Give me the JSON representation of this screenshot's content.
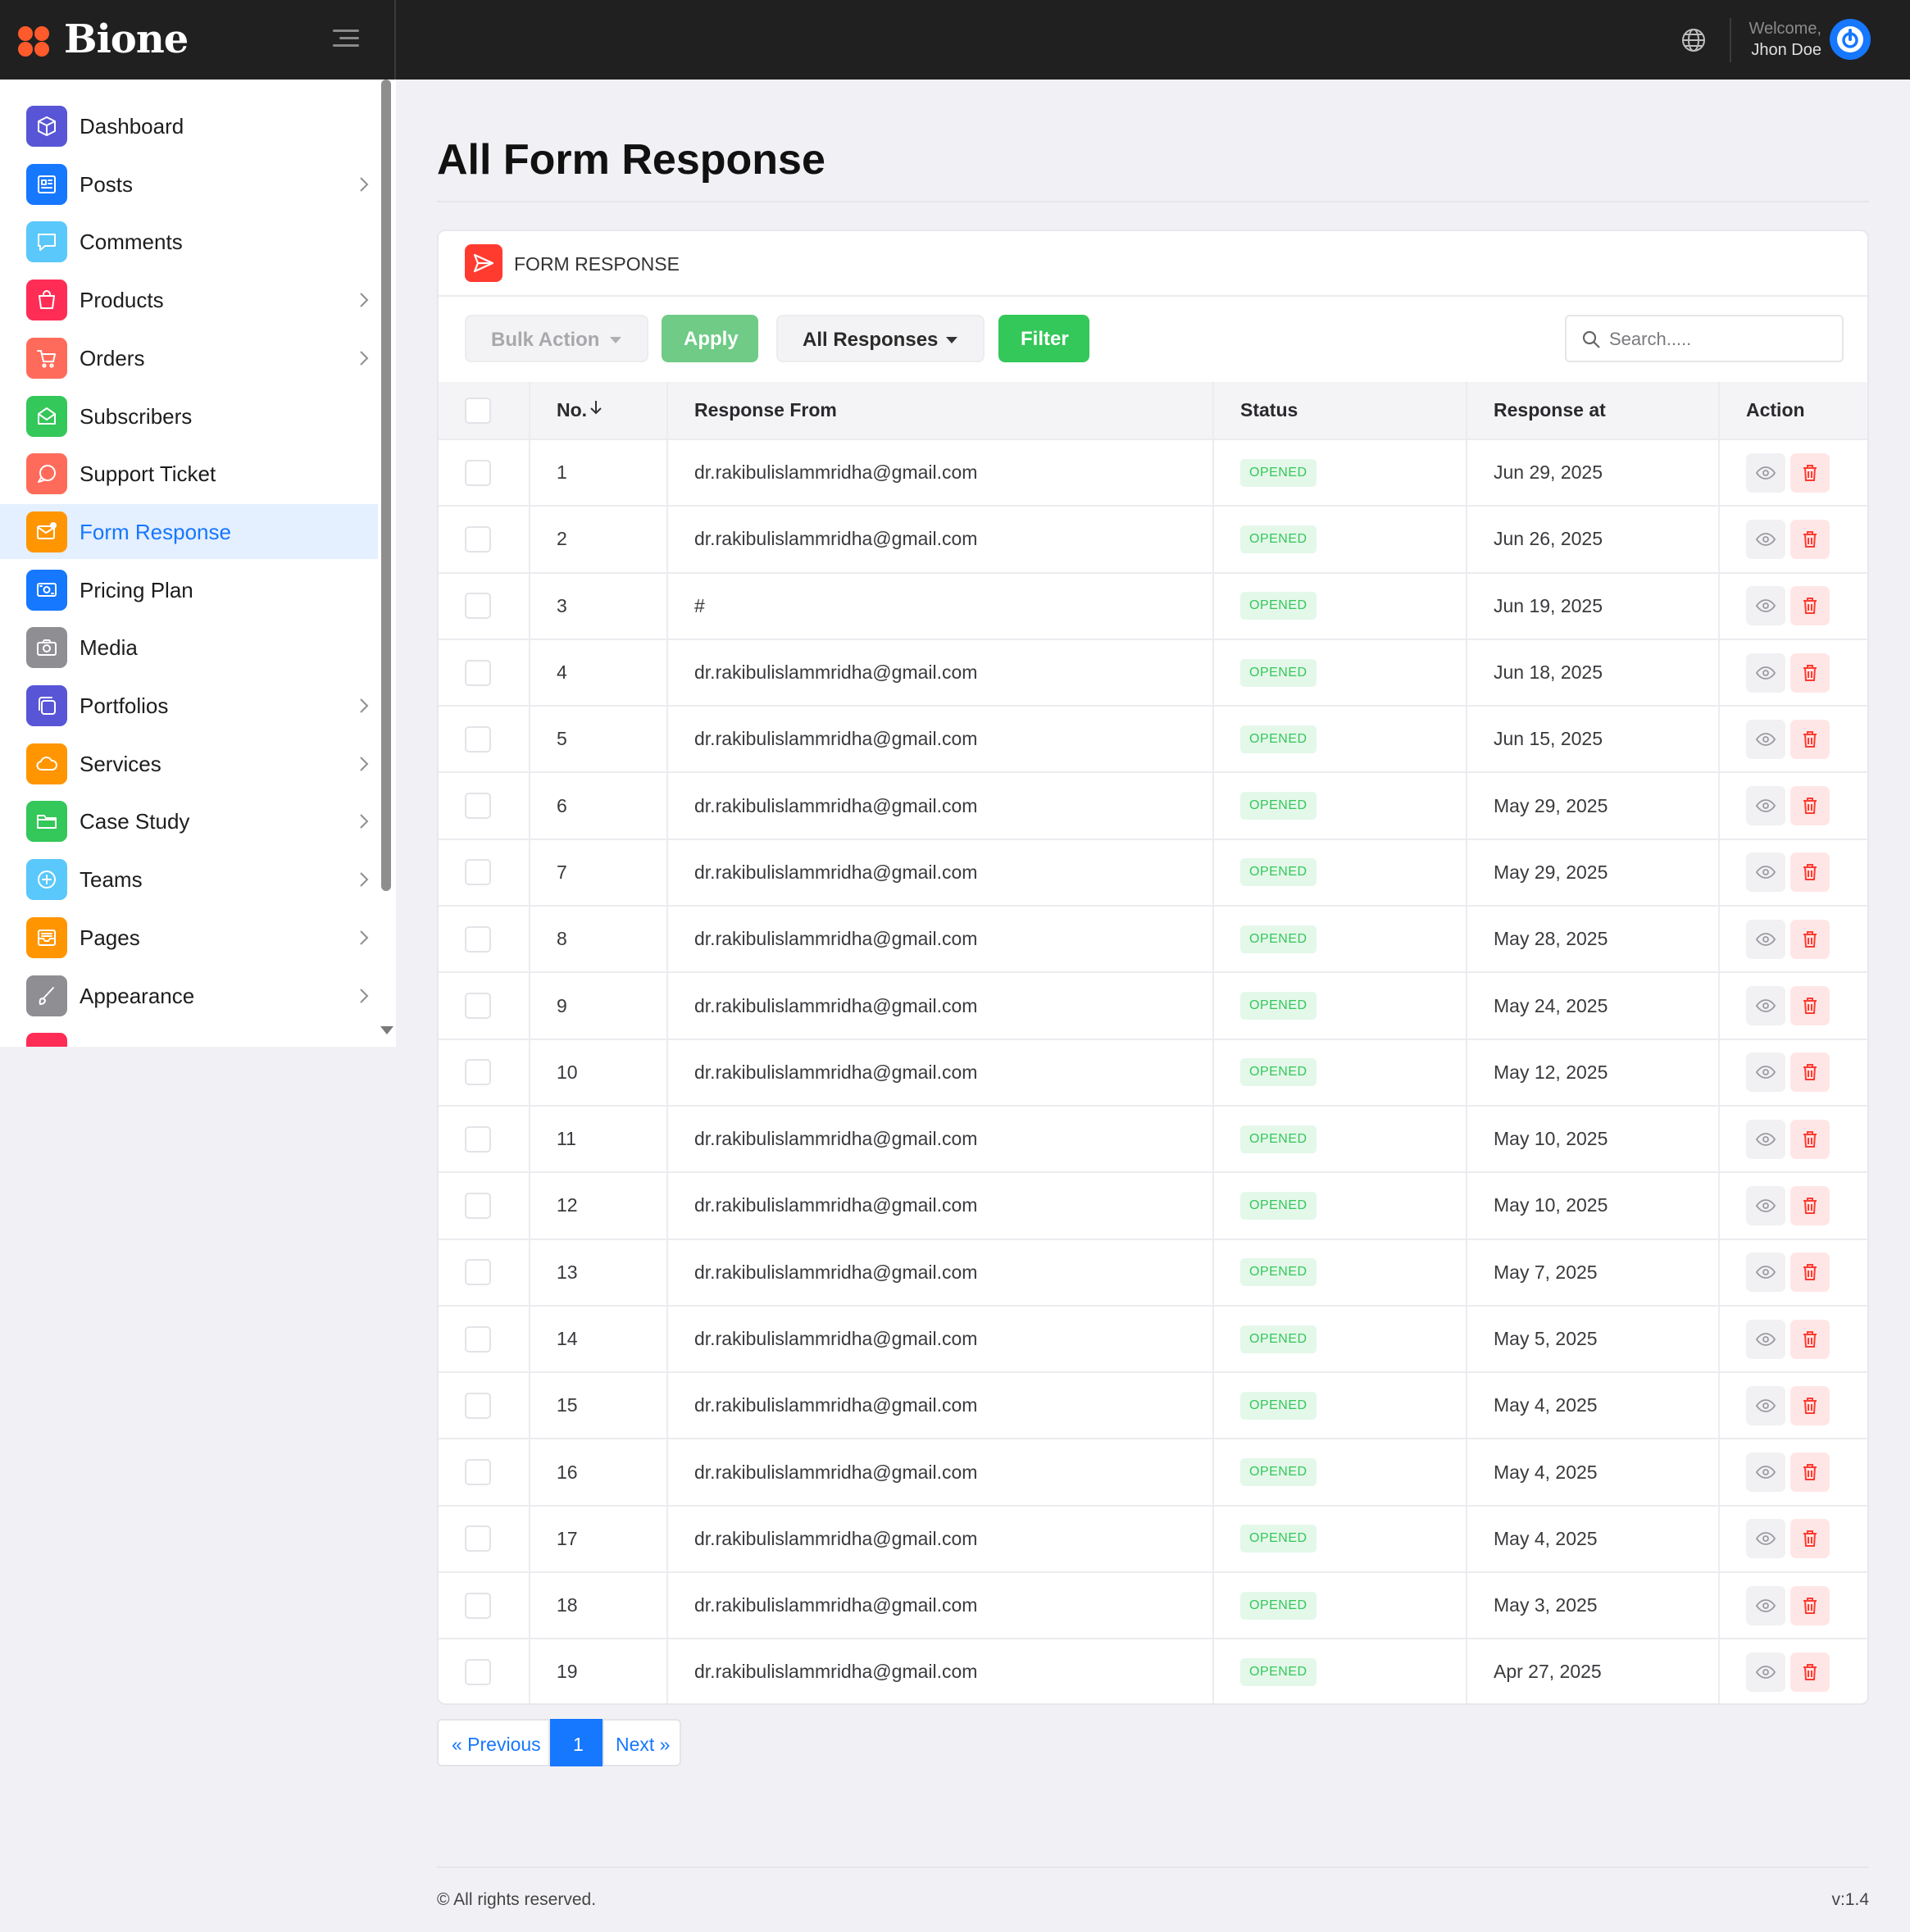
{
  "brand": {
    "name": "Bione"
  },
  "header": {
    "welcome": "Welcome,",
    "user": "Jhon Doe"
  },
  "sidebar": {
    "items": [
      {
        "label": "Dashboard",
        "icon": "cube-icon",
        "color": "#5856d6",
        "chevron": false,
        "active": false
      },
      {
        "label": "Posts",
        "icon": "newspaper-icon",
        "color": "#1677ff",
        "chevron": true,
        "active": false
      },
      {
        "label": "Comments",
        "icon": "chat-bubble-icon",
        "color": "#5ac8fa",
        "chevron": false,
        "active": false
      },
      {
        "label": "Products",
        "icon": "shopping-bag-icon",
        "color": "#ff2d55",
        "chevron": true,
        "active": false
      },
      {
        "label": "Orders",
        "icon": "cart-icon",
        "color": "#ff6b5b",
        "chevron": true,
        "active": false
      },
      {
        "label": "Subscribers",
        "icon": "envelope-open-icon",
        "color": "#34c759",
        "chevron": false,
        "active": false
      },
      {
        "label": "Support Ticket",
        "icon": "chat-support-icon",
        "color": "#ff6b5b",
        "chevron": false,
        "active": false
      },
      {
        "label": "Form Response",
        "icon": "mail-notification-icon",
        "color": "#ff9500",
        "chevron": false,
        "active": true
      },
      {
        "label": "Pricing Plan",
        "icon": "money-icon",
        "color": "#1677ff",
        "chevron": false,
        "active": false
      },
      {
        "label": "Media",
        "icon": "camera-icon",
        "color": "#8e8e93",
        "chevron": false,
        "active": false
      },
      {
        "label": "Portfolios",
        "icon": "copy-icon",
        "color": "#5856d6",
        "chevron": true,
        "active": false
      },
      {
        "label": "Services",
        "icon": "cloud-icon",
        "color": "#ff9500",
        "chevron": true,
        "active": false
      },
      {
        "label": "Case Study",
        "icon": "folder-icon",
        "color": "#34c759",
        "chevron": true,
        "active": false
      },
      {
        "label": "Teams",
        "icon": "plus-circle-icon",
        "color": "#5ac8fa",
        "chevron": true,
        "active": false
      },
      {
        "label": "Pages",
        "icon": "inbox-icon",
        "color": "#ff9500",
        "chevron": true,
        "active": false
      },
      {
        "label": "Appearance",
        "icon": "brush-icon",
        "color": "#8e8e93",
        "chevron": true,
        "active": false
      }
    ]
  },
  "main": {
    "title": "All Form Response",
    "card_title": "FORM RESPONSE",
    "toolbar": {
      "bulk_action": "Bulk Action",
      "apply": "Apply",
      "responses_filter": "All Responses",
      "filter": "Filter",
      "search_placeholder": "Search....."
    },
    "table": {
      "columns": [
        "No.",
        "Response From",
        "Status",
        "Response at",
        "Action"
      ],
      "rows": [
        {
          "no": "1",
          "from": "dr.rakibulislammridha@gmail.com",
          "status": "OPENED",
          "at": "Jun 29, 2025"
        },
        {
          "no": "2",
          "from": "dr.rakibulislammridha@gmail.com",
          "status": "OPENED",
          "at": "Jun 26, 2025"
        },
        {
          "no": "3",
          "from": "#",
          "status": "OPENED",
          "at": "Jun 19, 2025"
        },
        {
          "no": "4",
          "from": "dr.rakibulislammridha@gmail.com",
          "status": "OPENED",
          "at": "Jun 18, 2025"
        },
        {
          "no": "5",
          "from": "dr.rakibulislammridha@gmail.com",
          "status": "OPENED",
          "at": "Jun 15, 2025"
        },
        {
          "no": "6",
          "from": "dr.rakibulislammridha@gmail.com",
          "status": "OPENED",
          "at": "May 29, 2025"
        },
        {
          "no": "7",
          "from": "dr.rakibulislammridha@gmail.com",
          "status": "OPENED",
          "at": "May 29, 2025"
        },
        {
          "no": "8",
          "from": "dr.rakibulislammridha@gmail.com",
          "status": "OPENED",
          "at": "May 28, 2025"
        },
        {
          "no": "9",
          "from": "dr.rakibulislammridha@gmail.com",
          "status": "OPENED",
          "at": "May 24, 2025"
        },
        {
          "no": "10",
          "from": "dr.rakibulislammridha@gmail.com",
          "status": "OPENED",
          "at": "May 12, 2025"
        },
        {
          "no": "11",
          "from": "dr.rakibulislammridha@gmail.com",
          "status": "OPENED",
          "at": "May 10, 2025"
        },
        {
          "no": "12",
          "from": "dr.rakibulislammridha@gmail.com",
          "status": "OPENED",
          "at": "May 10, 2025"
        },
        {
          "no": "13",
          "from": "dr.rakibulislammridha@gmail.com",
          "status": "OPENED",
          "at": "May 7, 2025"
        },
        {
          "no": "14",
          "from": "dr.rakibulislammridha@gmail.com",
          "status": "OPENED",
          "at": "May 5, 2025"
        },
        {
          "no": "15",
          "from": "dr.rakibulislammridha@gmail.com",
          "status": "OPENED",
          "at": "May 4, 2025"
        },
        {
          "no": "16",
          "from": "dr.rakibulislammridha@gmail.com",
          "status": "OPENED",
          "at": "May 4, 2025"
        },
        {
          "no": "17",
          "from": "dr.rakibulislammridha@gmail.com",
          "status": "OPENED",
          "at": "May 4, 2025"
        },
        {
          "no": "18",
          "from": "dr.rakibulislammridha@gmail.com",
          "status": "OPENED",
          "at": "May 3, 2025"
        },
        {
          "no": "19",
          "from": "dr.rakibulislammridha@gmail.com",
          "status": "OPENED",
          "at": "Apr 27, 2025"
        }
      ]
    },
    "pagination": {
      "prev": "« Previous",
      "current": "1",
      "next": "Next »"
    }
  },
  "footer": {
    "copyright": "© All rights reserved.",
    "version": "v:1.4"
  },
  "colors": {
    "accent": "#1677ff",
    "success": "#34c759",
    "danger": "#ff3b30",
    "topbar": "#202020"
  }
}
